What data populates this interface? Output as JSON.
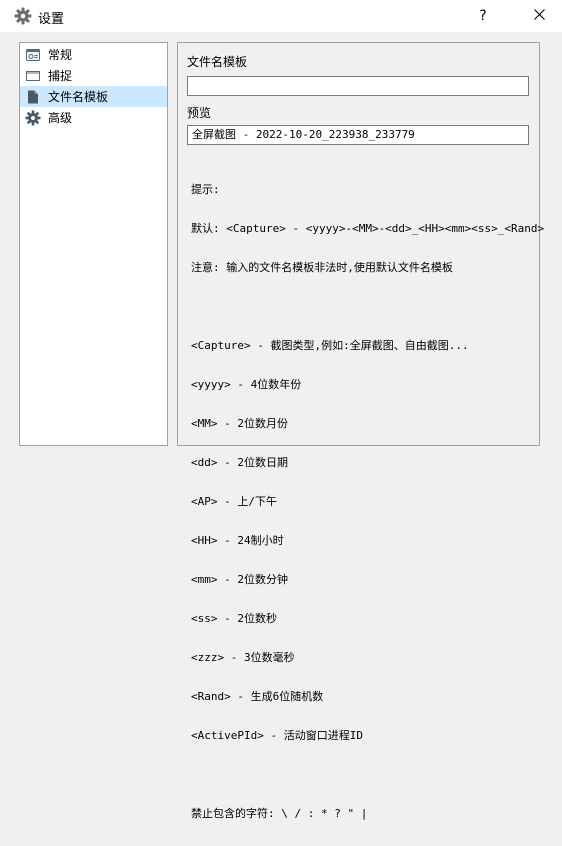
{
  "window": {
    "title": "设置",
    "help_label": "?",
    "close_label": "✕"
  },
  "sidebar": {
    "items": [
      {
        "label": "常规",
        "icon": "general-icon"
      },
      {
        "label": "捕捉",
        "icon": "capture-icon"
      },
      {
        "label": "文件名模板",
        "icon": "file-icon",
        "selected": true
      },
      {
        "label": "高级",
        "icon": "gear-icon"
      }
    ]
  },
  "template": {
    "label": "文件名模板",
    "value": "",
    "preview_label": "预览",
    "preview_value": "全屏截图 - 2022-10-20_223938_233779"
  },
  "help": {
    "lines": [
      "提示:",
      "默认: <Capture> - <yyyy>-<MM>-<dd>_<HH><mm><ss>_<Rand>",
      "注意: 输入的文件名模板非法时,使用默认文件名模板",
      "",
      "<Capture> - 截图类型,例如:全屏截图、自由截图...",
      "<yyyy> - 4位数年份",
      "<MM> - 2位数月份",
      "<dd> - 2位数日期",
      "<AP> - 上/下午",
      "<HH> - 24制小时",
      "<mm> - 2位数分钟",
      "<ss> - 2位数秒",
      "<zzz> - 3位数毫秒",
      "<Rand> - 生成6位随机数",
      "<ActivePId> - 活动窗口进程ID",
      "",
      "禁止包含的字符: \\ / : * ? \" |"
    ]
  }
}
